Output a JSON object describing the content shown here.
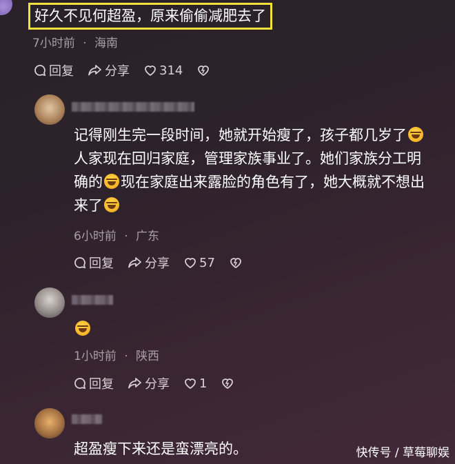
{
  "top_comment": {
    "text": "好久不见何超盈，原来偷偷减肥去了",
    "time": "7小时前",
    "location": "海南",
    "reply_label": "回复",
    "share_label": "分享",
    "likes": "314"
  },
  "replies": [
    {
      "line1": "记得刚生完一段时间，她就开始瘦了，孩子都几岁了",
      "line2": "人家现在回归家庭，管理家族事业了。她们家族分工明",
      "line3a": "确的",
      "line3b": "现在家庭出来露脸的角色有了，她大概就不想出",
      "line4": "来了",
      "time": "6小时前",
      "location": "广东",
      "reply_label": "回复",
      "share_label": "分享",
      "likes": "57"
    },
    {
      "time": "1小时前",
      "location": "陕西",
      "reply_label": "回复",
      "share_label": "分享",
      "likes": "1"
    },
    {
      "text": "超盈瘦下来还是蛮漂亮的。"
    }
  ],
  "meta_separator": "·",
  "watermark": "快传号 / 草莓聊娱",
  "colors": {
    "highlight_border": "#f0e23a",
    "meta_text": "#a89ea6",
    "action_text": "#d9d0d6"
  },
  "icons": [
    "reply-icon",
    "share-icon",
    "heart-icon",
    "dislike-heart-icon",
    "laughing-tears-emoji"
  ]
}
